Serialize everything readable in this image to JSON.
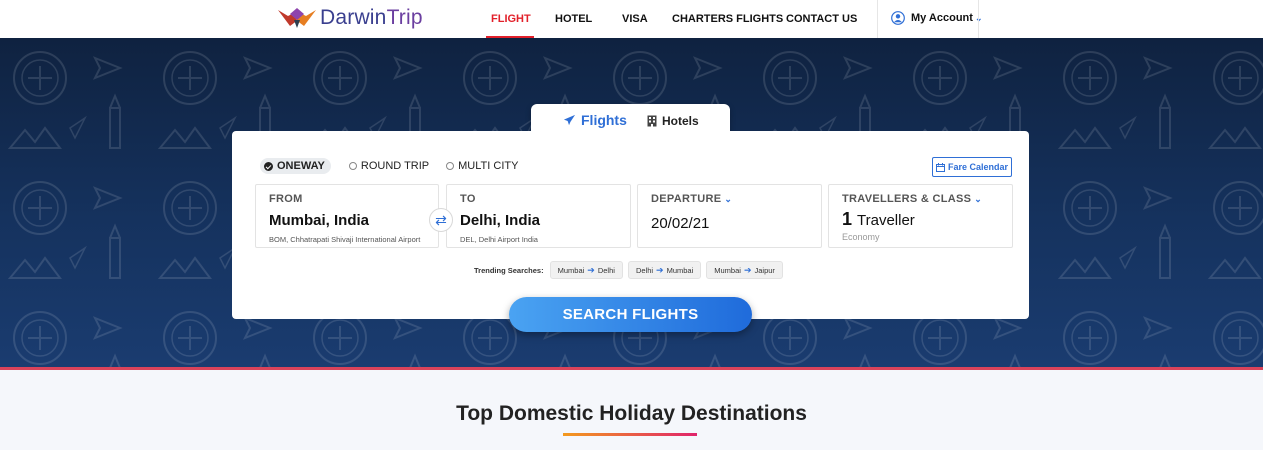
{
  "brand": {
    "name_part1": "Darwin",
    "name_part2": "Trip"
  },
  "nav": {
    "items": [
      {
        "label": "FLIGHT"
      },
      {
        "label": "HOTEL"
      },
      {
        "label": "VISA"
      },
      {
        "label": "CHARTERS FLIGHTS"
      },
      {
        "label": "CONTACT US"
      }
    ],
    "account_label": "My Account"
  },
  "search_tabs": {
    "flights": "Flights",
    "hotels": "Hotels"
  },
  "trip_types": {
    "oneway": "ONEWAY",
    "round_trip": "ROUND TRIP",
    "multi_city": "MULTI CITY",
    "selected": "ONEWAY"
  },
  "fare_calendar_label": "Fare Calendar",
  "from": {
    "label": "FROM",
    "city": "Mumbai, India",
    "airport": "BOM, Chhatrapati Shivaji International Airport"
  },
  "to": {
    "label": "TO",
    "city": "Delhi, India",
    "airport": "DEL, Delhi Airport India"
  },
  "departure": {
    "label": "DEPARTURE",
    "date": "20/02/21"
  },
  "travellers": {
    "label": "TRAVELLERS & CLASS",
    "count": "1",
    "unit": "Traveller",
    "class": "Economy"
  },
  "trending": {
    "label": "Trending Searches:",
    "items": [
      {
        "from": "Mumbai",
        "to": "Delhi"
      },
      {
        "from": "Delhi",
        "to": "Mumbai"
      },
      {
        "from": "Mumbai",
        "to": "Jaipur"
      }
    ]
  },
  "search_button_label": "SEARCH FLIGHTS",
  "section_title": "Top Domestic Holiday Destinations",
  "colors": {
    "accent": "#2f6fd6",
    "nav_active": "#e2202a",
    "hero": "#15325e"
  }
}
